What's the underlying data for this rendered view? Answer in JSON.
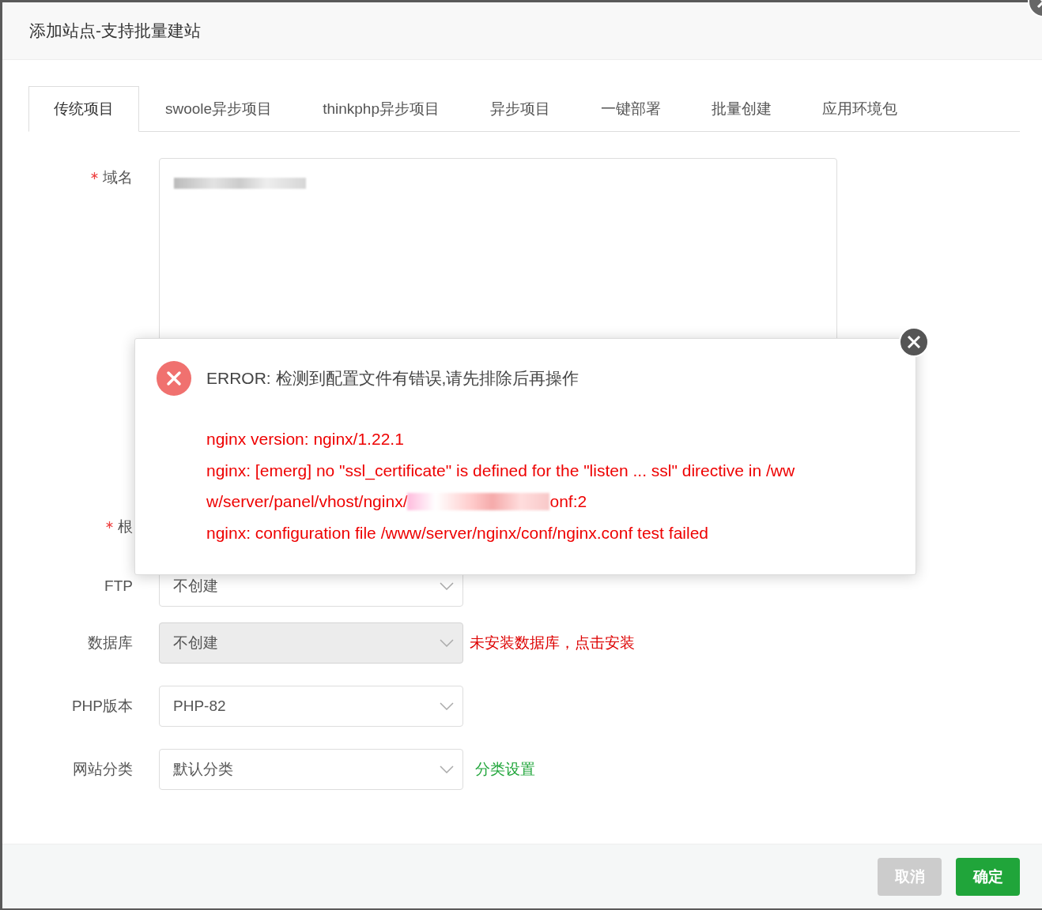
{
  "dialog": {
    "title": "添加站点-支持批量建站"
  },
  "tabs": [
    {
      "label": "传统项目",
      "selected": true
    },
    {
      "label": "swoole异步项目",
      "selected": false
    },
    {
      "label": "thinkphp异步项目",
      "selected": false
    },
    {
      "label": "异步项目",
      "selected": false
    },
    {
      "label": "一键部署",
      "selected": false
    },
    {
      "label": "批量创建",
      "selected": false
    },
    {
      "label": "应用环境包",
      "selected": false
    }
  ],
  "form": [
    {
      "kind": "textarea",
      "label": "域名",
      "required": true
    },
    {
      "kind": "hidden",
      "label": "根",
      "required": true
    },
    {
      "kind": "select",
      "label": "FTP",
      "required": false,
      "value": "不创建",
      "disabled": false
    },
    {
      "kind": "select",
      "label": "数据库",
      "required": false,
      "value": "不创建",
      "disabled": true,
      "hint": {
        "text": "未安装数据库，点击安装",
        "color": "#dd0000"
      }
    },
    {
      "kind": "select",
      "label": "PHP版本",
      "required": false,
      "value": "PHP-82",
      "disabled": false
    },
    {
      "kind": "select",
      "label": "网站分类",
      "required": false,
      "value": "默认分类",
      "disabled": false,
      "hint": {
        "text": "分类设置",
        "color": "#20a53a"
      }
    }
  ],
  "error_popup": {
    "title": "ERROR: 检测到配置文件有错误,请先排除后再操作",
    "lines": [
      {
        "parts": [
          "nginx version: nginx/1.22.1"
        ]
      },
      {
        "parts": [
          "nginx: [emerg] no \"ssl_certificate\" is defined for the \"listen ... ssl\" directive in /ww"
        ]
      },
      {
        "parts": [
          "w/server/panel/vhost/nginx/",
          "onf:2"
        ]
      },
      {
        "parts": [
          "nginx: configuration file /www/server/nginx/conf/nginx.conf test failed"
        ]
      }
    ]
  },
  "buttons": [
    {
      "label": "取消",
      "kind": "secondary"
    },
    {
      "label": "确定",
      "kind": "primary"
    }
  ]
}
